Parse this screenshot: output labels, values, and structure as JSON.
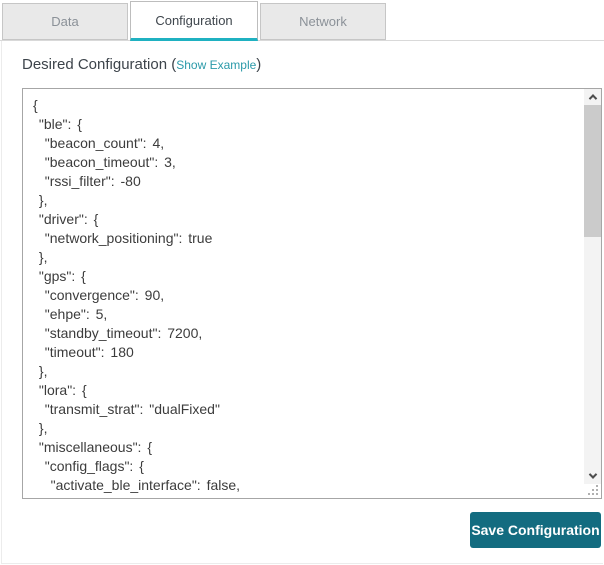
{
  "tabs": {
    "data": "Data",
    "configuration": "Configuration",
    "network": "Network",
    "active_tab": "Configuration"
  },
  "config_section": {
    "label": "Desired Configuration",
    "paren_open": "(",
    "link": "Show Example",
    "paren_close": ")",
    "editor_content": "{\n \"ble\": {\n  \"beacon_count\": 4,\n  \"beacon_timeout\": 3,\n  \"rssi_filter\": -80\n },\n \"driver\": {\n  \"network_positioning\": true\n },\n \"gps\": {\n  \"convergence\": 90,\n  \"ehpe\": 5,\n  \"standby_timeout\": 7200,\n  \"timeout\": 180\n },\n \"lora\": {\n  \"transmit_strat\": \"dualFixed\"\n },\n \"miscellaneous\": {\n  \"config_flags\": {\n   \"activate_ble_interface\": false,"
  },
  "actions": {
    "save": "Save Configuration"
  },
  "colors": {
    "active_tab_underline": "#1fb1c1",
    "link_teal": "#2b9aa9",
    "save_button_teal": "#136c80",
    "inactive_tab_bg": "#e9e9e9",
    "inactive_tab_text": "#8b9198"
  }
}
